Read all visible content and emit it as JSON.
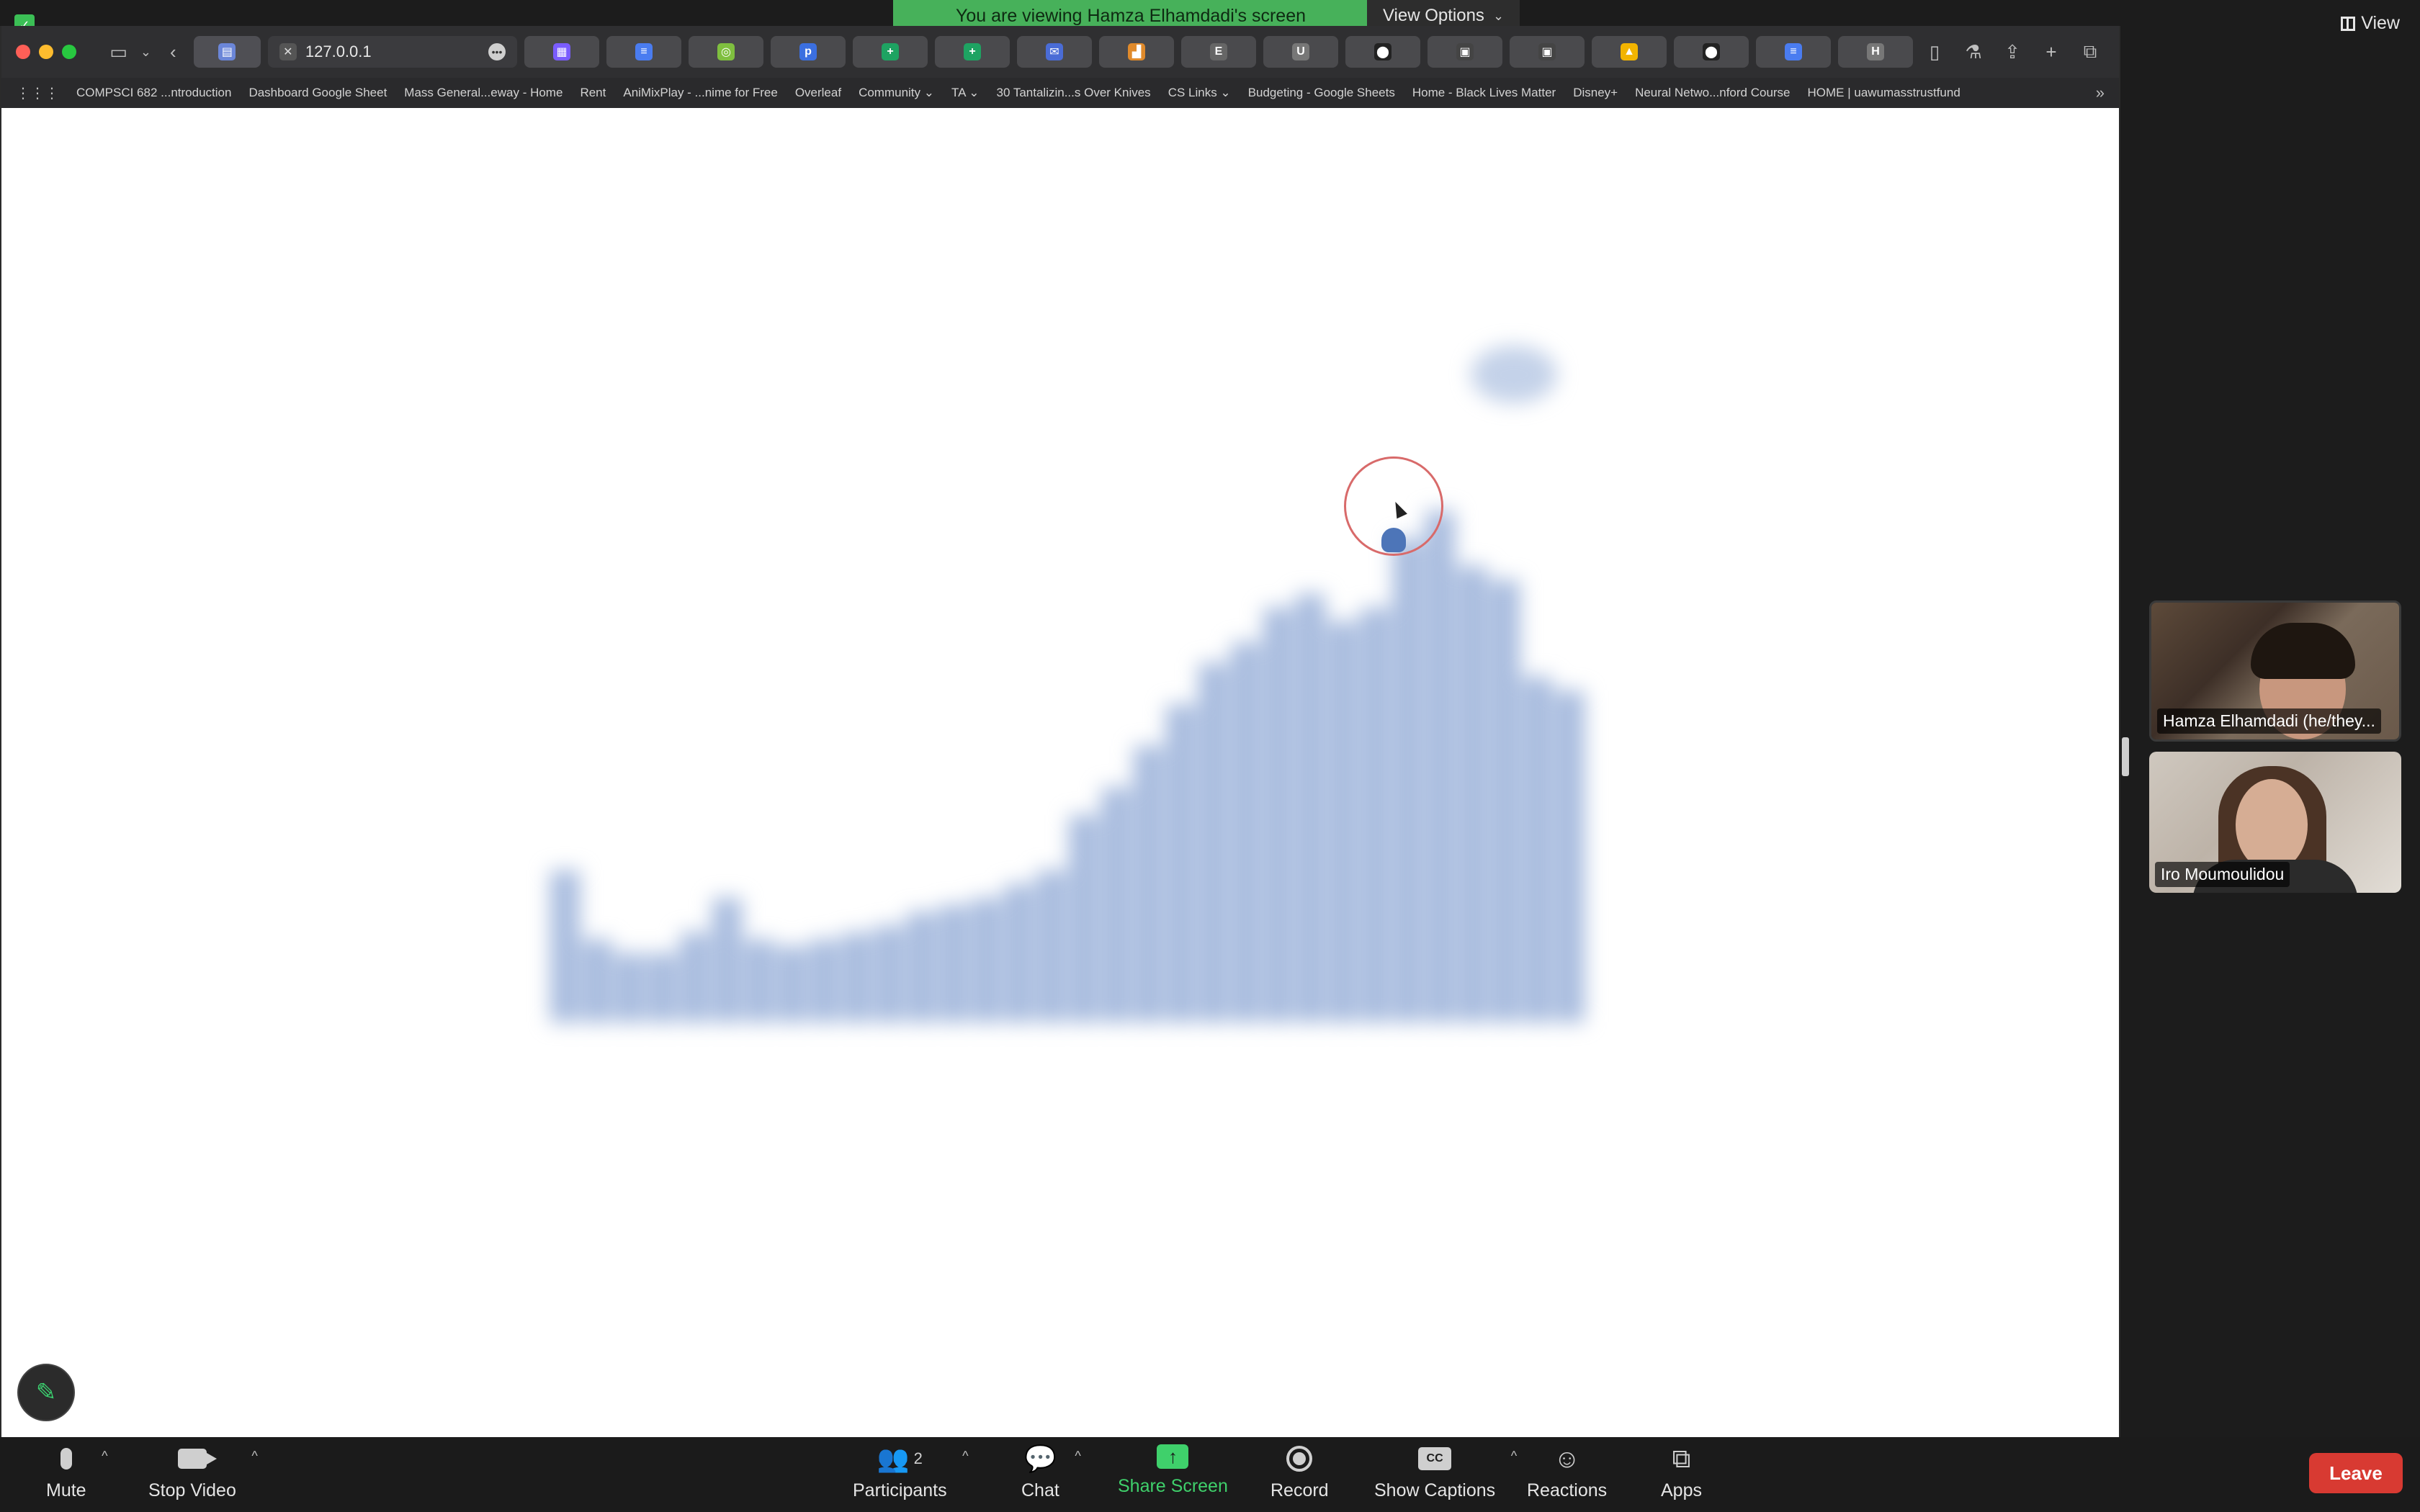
{
  "zoom": {
    "banner_text": "You are viewing Hamza Elhamdadi's screen",
    "view_options_label": "View Options",
    "view_label": "View",
    "controls": {
      "mute": "Mute",
      "stop_video": "Stop Video",
      "participants": "Participants",
      "participants_count": "2",
      "chat": "Chat",
      "share_screen": "Share Screen",
      "record": "Record",
      "show_captions": "Show Captions",
      "captions_icon_text": "CC",
      "reactions": "Reactions",
      "apps": "Apps",
      "leave": "Leave"
    },
    "participants": [
      {
        "name": "Hamza Elhamdadi (he/they..."
      },
      {
        "name": "Iro Moumoulidou"
      }
    ]
  },
  "browser": {
    "active_tab_url": "127.0.0.1",
    "tab_favicons": [
      {
        "letter": "▦",
        "color": "#7a5cff"
      },
      {
        "letter": "≡",
        "color": "#4a7cf0"
      },
      {
        "letter": "◎",
        "color": "#7fbf3f"
      },
      {
        "letter": "p",
        "color": "#3b6fe0"
      },
      {
        "letter": "+",
        "color": "#1ea362"
      },
      {
        "letter": "+",
        "color": "#1ea362"
      },
      {
        "letter": "✉",
        "color": "#4a6cd6"
      },
      {
        "letter": "▟",
        "color": "#e08a2b"
      },
      {
        "letter": "E",
        "color": "#666"
      },
      {
        "letter": "U",
        "color": "#777"
      },
      {
        "letter": "⬤",
        "color": "#222"
      },
      {
        "letter": "▣",
        "color": "#444"
      },
      {
        "letter": "▣",
        "color": "#444"
      },
      {
        "letter": "▲",
        "color": "#f2b400"
      },
      {
        "letter": "⬤",
        "color": "#222"
      },
      {
        "letter": "≡",
        "color": "#4a7cf0"
      },
      {
        "letter": "H",
        "color": "#777"
      }
    ],
    "bookmarks": [
      "COMPSCI 682 ...ntroduction",
      "Dashboard Google Sheet",
      "Mass General...eway - Home",
      "Rent",
      "AniMixPlay - ...nime for Free",
      "Overleaf",
      "Community ⌄",
      "TA ⌄",
      "30 Tantalizin...s Over Knives",
      "CS Links ⌄",
      "Budgeting - Google Sheets",
      "Home - Black Lives Matter",
      "Disney+",
      "Neural Netwo...nford Course",
      "HOME | uawumasstrustfund"
    ]
  },
  "colors": {
    "banner_green": "#47b15a",
    "leave_red": "#d83a32",
    "share_green": "#3fd06b",
    "chart_blue": "#9db4da",
    "cursor_ring": "#d86a6a"
  }
}
